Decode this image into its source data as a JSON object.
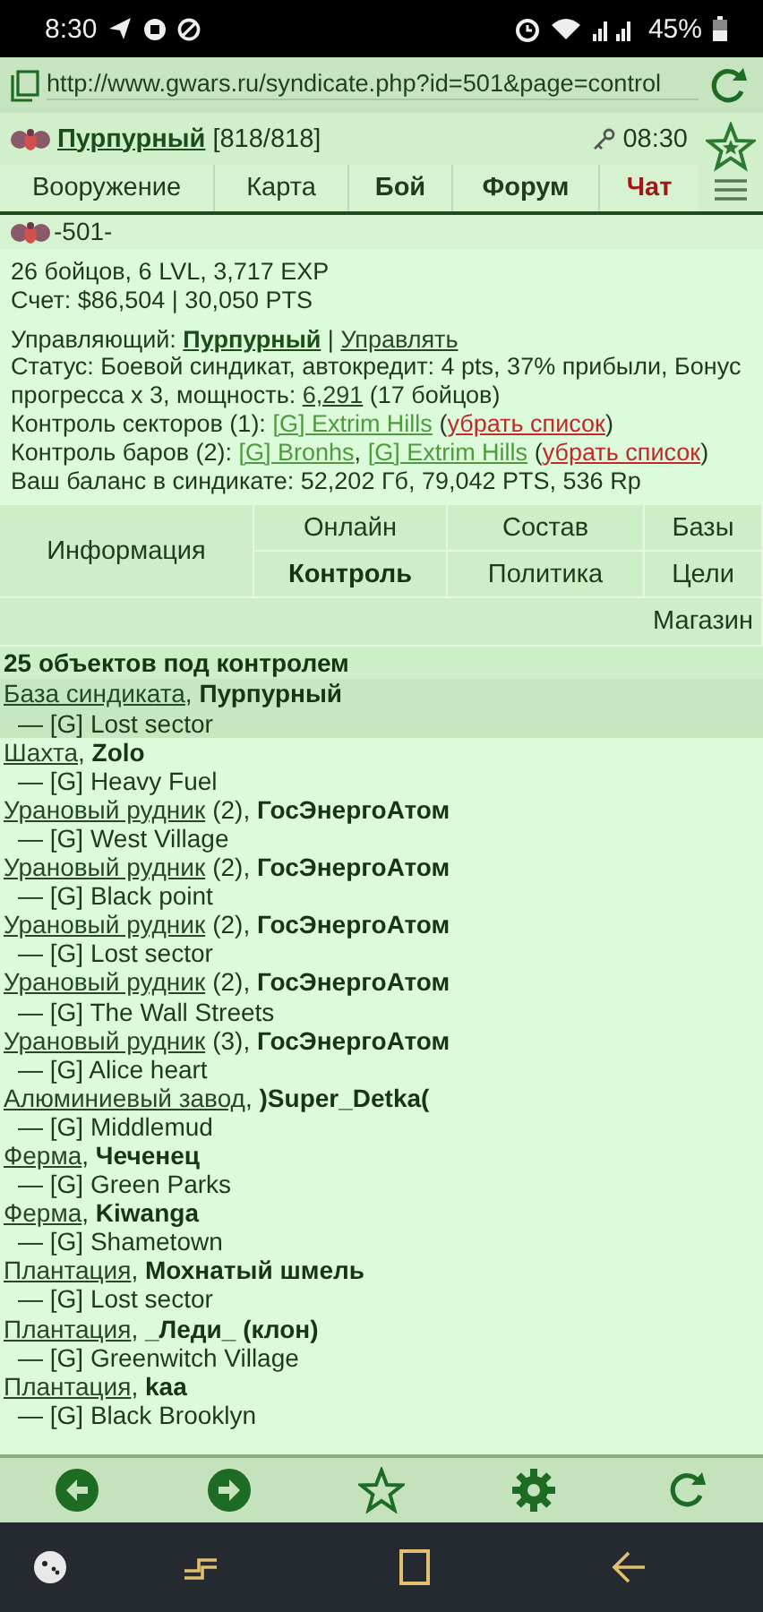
{
  "status_bar": {
    "time": "8:30",
    "battery": "45%"
  },
  "address_bar": {
    "url": "http://www.gwars.ru/syndicate.php?id=501&page=control"
  },
  "header": {
    "player": "Пурпурный",
    "hp": "[818/818]",
    "time": "08:30"
  },
  "nav": [
    {
      "label": "Вооружение",
      "kind": "plain"
    },
    {
      "label": "Карта",
      "kind": "plain"
    },
    {
      "label": "Бой",
      "kind": "bold"
    },
    {
      "label": "Форум",
      "kind": "bold"
    },
    {
      "label": "Чат",
      "kind": "alert"
    }
  ],
  "syndicate": {
    "number": "-501-"
  },
  "info_blocks": [
    [
      [
        {
          "kind": "text",
          "text": "26 бойцов, 6 LVL, 3,717 EXP"
        }
      ],
      [
        {
          "kind": "text",
          "text": "Счет: $86,504 | 30,050 PTS"
        }
      ]
    ],
    [
      [
        {
          "kind": "text",
          "text": "Управляющий: "
        },
        {
          "kind": "bold-link",
          "text": "Пурпурный"
        },
        {
          "kind": "text",
          "text": " | "
        },
        {
          "kind": "link",
          "text": "Управлять"
        }
      ],
      [
        {
          "kind": "text",
          "text": "Статус: Боевой синдикат, автокредит: 4 pts, 37% прибыли, Бонус прогресса х 3, мощность: "
        },
        {
          "kind": "link",
          "text": "6,291"
        },
        {
          "kind": "text",
          "text": " (17 бойцов)"
        }
      ],
      [
        {
          "kind": "text",
          "text": "Контроль секторов (1): "
        },
        {
          "kind": "green-link",
          "text": "[G] Extrim Hills"
        },
        {
          "kind": "text",
          "text": " ("
        },
        {
          "kind": "red-link",
          "text": "убрать список"
        },
        {
          "kind": "text",
          "text": ")"
        }
      ],
      [
        {
          "kind": "text",
          "text": "Контроль баров (2): "
        },
        {
          "kind": "green-link",
          "text": "[G] Bronhs"
        },
        {
          "kind": "text",
          "text": ", "
        },
        {
          "kind": "green-link",
          "text": "[G] Extrim Hills"
        },
        {
          "kind": "text",
          "text": " ("
        },
        {
          "kind": "red-link",
          "text": "убрать список"
        },
        {
          "kind": "text",
          "text": ")"
        }
      ],
      [
        {
          "kind": "text",
          "text": "Ваш баланс в синдикате: 52,202 Гб, 79,042 PTS, 536 Rp"
        }
      ]
    ]
  ],
  "sections": {
    "title": "Информация",
    "tabs": [
      {
        "label": "Онлайн",
        "selected": false
      },
      {
        "label": "Состав",
        "selected": false
      },
      {
        "label": "Базы",
        "selected": false
      },
      {
        "label": "Контроль",
        "selected": true
      },
      {
        "label": "Политика",
        "selected": false
      },
      {
        "label": "Цели",
        "selected": false
      },
      {
        "label": "Магазин",
        "selected": false
      }
    ]
  },
  "objects": {
    "title": "25 объектов под контролем",
    "comma": ",",
    "items": [
      {
        "type": "База синдиката",
        "owner": "Пурпурный",
        "sector": "— [G] Lost sector",
        "highlighted": true
      },
      {
        "type": "Шахта",
        "owner": "Zolo",
        "sector": "— [G] Heavy Fuel",
        "highlighted": false
      },
      {
        "type": "Урановый рудник",
        "count": "(2)",
        "owner": "ГосЭнергоАтом",
        "sector": "— [G] West Village",
        "highlighted": false
      },
      {
        "type": "Урановый рудник",
        "count": "(2)",
        "owner": "ГосЭнергоАтом",
        "sector": "— [G] Black point",
        "highlighted": false
      },
      {
        "type": "Урановый рудник",
        "count": "(2)",
        "owner": "ГосЭнергоАтом",
        "sector": "— [G] Lost sector",
        "highlighted": false
      },
      {
        "type": "Урановый рудник",
        "count": "(2)",
        "owner": "ГосЭнергоАтом",
        "sector": "— [G] The Wall Streets",
        "highlighted": false
      },
      {
        "type": "Урановый рудник",
        "count": "(3)",
        "owner": "ГосЭнергоАтом",
        "sector": "— [G] Alice heart",
        "highlighted": false
      },
      {
        "type": "Алюминиевый завод",
        "owner": ")Super_Detka(",
        "sector": "— [G] Middlemud",
        "highlighted": false
      },
      {
        "type": "Ферма",
        "owner": "Чеченец",
        "sector": "— [G] Green Parks",
        "highlighted": false
      },
      {
        "type": "Ферма",
        "owner": "Kiwanga",
        "sector": "— [G] Shametown",
        "highlighted": false
      },
      {
        "type": "Плантация",
        "owner": "Мохнатый шмель",
        "sector": "— [G] Lost sector",
        "highlighted": false
      },
      {
        "type": "Плантация",
        "owner": "_Леди_ (клон)",
        "sector": "— [G] Greenwitch Village",
        "highlighted": false
      },
      {
        "type": "Плантация",
        "owner": "kaa",
        "sector": "— [G] Black Brooklyn",
        "highlighted": false
      }
    ]
  }
}
